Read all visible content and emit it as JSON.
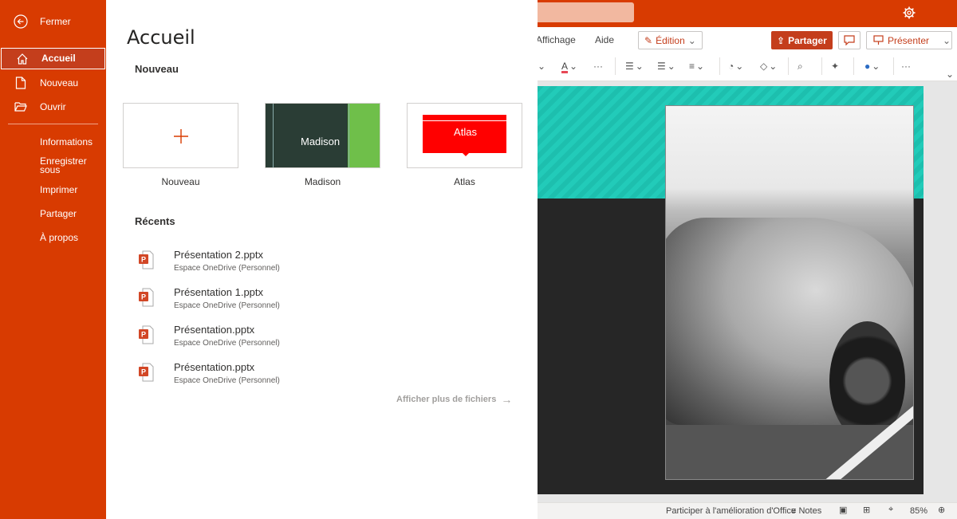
{
  "colors": {
    "brand": "#d83b01",
    "brand_dark": "#c43e1c",
    "slide_accent": "#1dbfae"
  },
  "app_tabs": {
    "affichage": "Affichage",
    "aide": "Aide"
  },
  "app_toolbar": {
    "edition": "Édition",
    "partager": "Partager",
    "presenter": "Présenter"
  },
  "status": {
    "feedback": "Participer à l'amélioration d'Office",
    "notes": "Notes",
    "zoom": "85%"
  },
  "nav": {
    "close": "Fermer",
    "items": [
      {
        "label": "Accueil",
        "icon": "home-icon",
        "active": true
      },
      {
        "label": "Nouveau",
        "icon": "new-document-icon"
      },
      {
        "label": "Ouvrir",
        "icon": "open-folder-icon"
      }
    ],
    "links": [
      "Informations",
      "Enregistrer sous",
      "Imprimer",
      "Partager",
      "À propos"
    ]
  },
  "main": {
    "title": "Accueil",
    "new_section": "Nouveau",
    "templates": [
      {
        "label": "Nouveau",
        "preview": ""
      },
      {
        "label": "Madison",
        "preview": "Madison"
      },
      {
        "label": "Atlas",
        "preview": "Atlas"
      }
    ],
    "recent_section": "Récents",
    "recent_files": [
      {
        "name": "Présentation 2.pptx",
        "location": "Espace OneDrive (Personnel)"
      },
      {
        "name": "Présentation 1.pptx",
        "location": "Espace OneDrive (Personnel)"
      },
      {
        "name": "Présentation.pptx",
        "location": "Espace OneDrive (Personnel)"
      },
      {
        "name": "Présentation.pptx",
        "location": "Espace OneDrive (Personnel)"
      }
    ],
    "more_files": "Afficher plus de fichiers"
  }
}
